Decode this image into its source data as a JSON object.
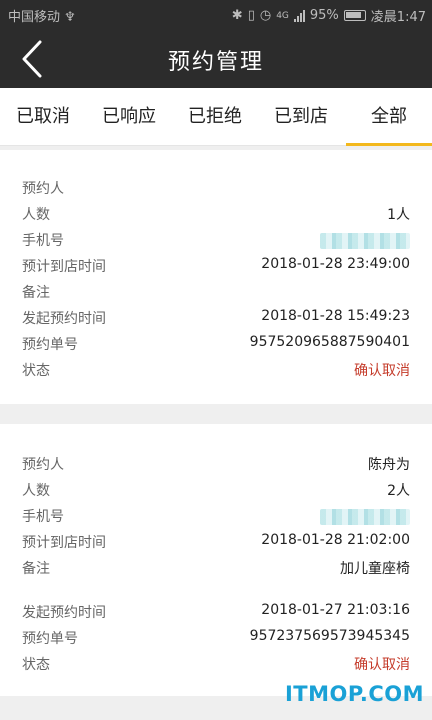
{
  "status_bar": {
    "carrier": "中国移动 ♆",
    "network": "4G",
    "battery": "95%",
    "time": "凌晨1:47"
  },
  "header": {
    "title": "预约管理"
  },
  "tabs": [
    {
      "label": "已取消"
    },
    {
      "label": "已响应"
    },
    {
      "label": "已拒绝"
    },
    {
      "label": "已到店"
    },
    {
      "label": "全部",
      "active": true
    }
  ],
  "colors": {
    "accent": "#f3b81c",
    "status_red": "#c53c2b",
    "header_bg": "#2c2c2c"
  },
  "cards": [
    {
      "fields": [
        {
          "label": "预约人",
          "value": ""
        },
        {
          "label": "人数",
          "value": "1人"
        },
        {
          "label": "手机号",
          "value": ""
        },
        {
          "label": "预计到店时间",
          "value": "2018-01-28 23:49:00"
        },
        {
          "label": "备注",
          "value": ""
        },
        {
          "label": "发起预约时间",
          "value": "2018-01-28 15:49:23"
        },
        {
          "label": "预约单号",
          "value": "957520965887590401"
        },
        {
          "label": "状态",
          "value": "确认取消"
        }
      ]
    },
    {
      "fields": [
        {
          "label": "预约人",
          "value": "陈舟为"
        },
        {
          "label": "人数",
          "value": "2人"
        },
        {
          "label": "手机号",
          "value": ""
        },
        {
          "label": "预计到店时间",
          "value": "2018-01-28 21:02:00"
        },
        {
          "label": "备注",
          "value": "加儿童座椅"
        },
        {
          "label": "发起预约时间",
          "value": "2018-01-27 21:03:16"
        },
        {
          "label": "预约单号",
          "value": "957237569573945345"
        },
        {
          "label": "状态",
          "value": "确认取消"
        }
      ]
    }
  ],
  "watermark": "ITMOP.COM"
}
